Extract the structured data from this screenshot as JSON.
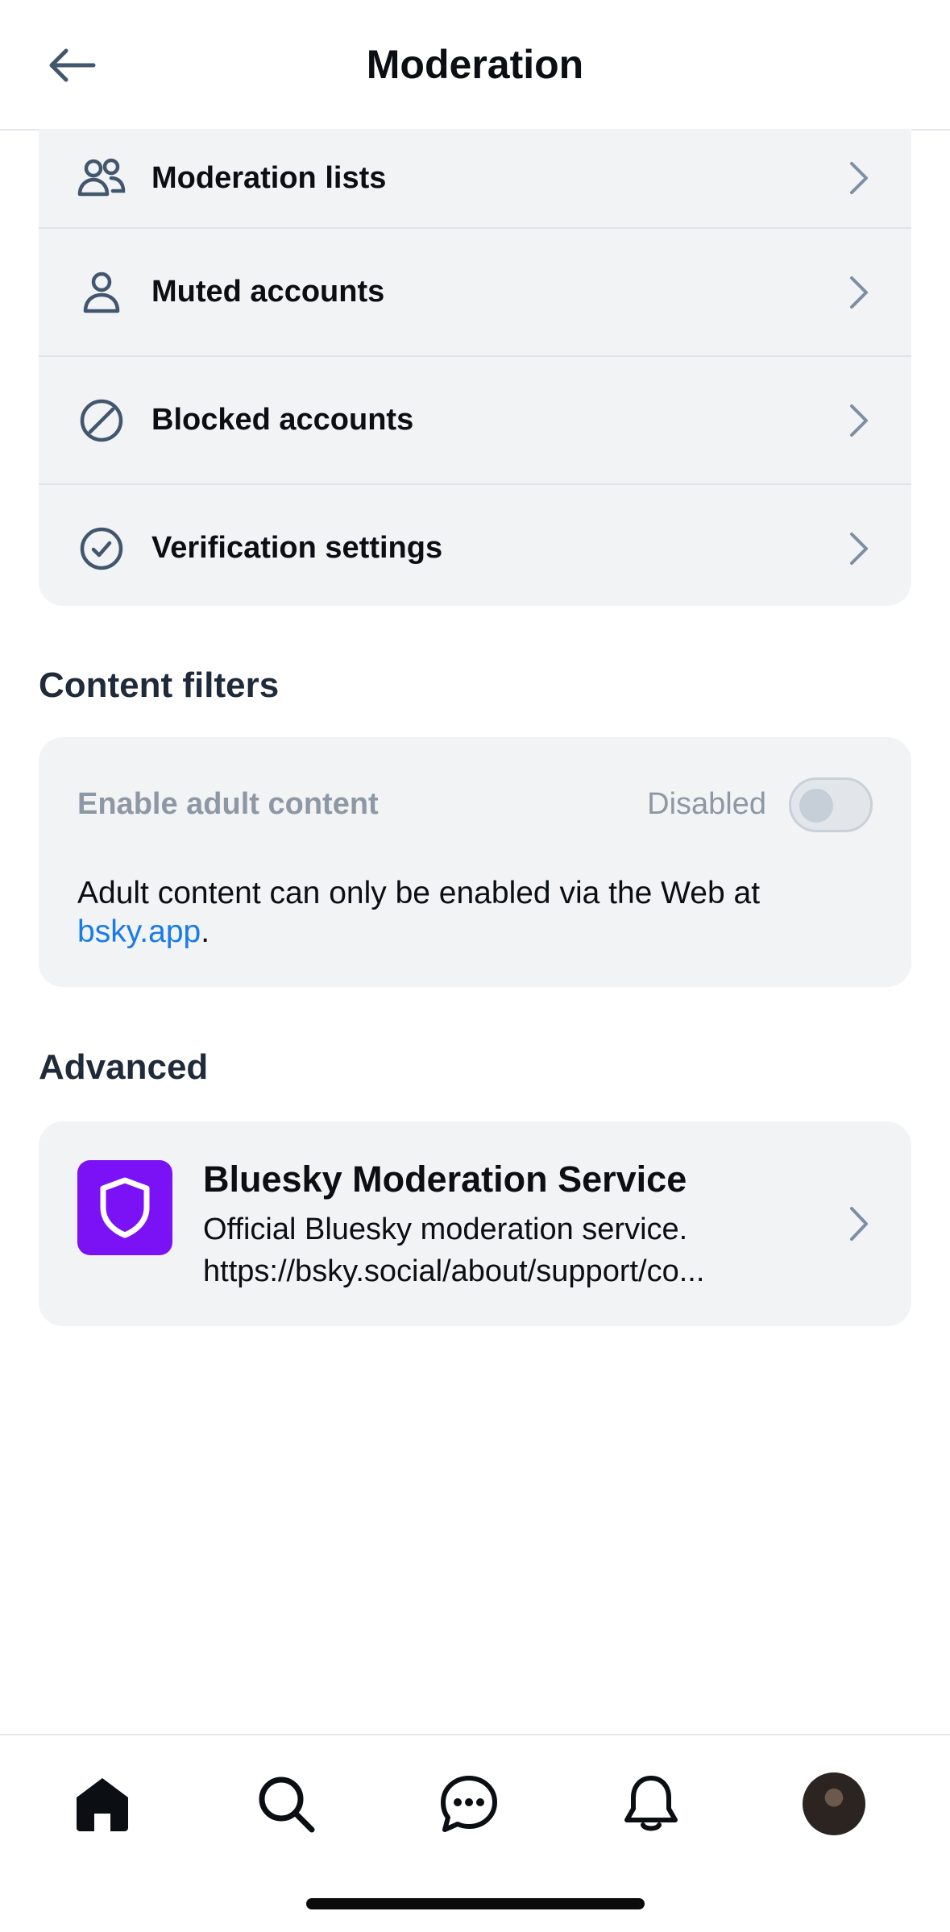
{
  "header": {
    "title": "Moderation",
    "back_icon": "arrow-left-icon"
  },
  "menu": {
    "items": [
      {
        "label": "Moderation lists",
        "icon": "people-icon"
      },
      {
        "label": "Muted accounts",
        "icon": "person-icon"
      },
      {
        "label": "Blocked accounts",
        "icon": "circle-slash-icon"
      },
      {
        "label": "Verification settings",
        "icon": "circle-check-icon"
      }
    ]
  },
  "content_filters": {
    "title": "Content filters",
    "adult_label": "Enable adult content",
    "status": "Disabled",
    "enabled": false,
    "note_prefix": "Adult content can only be enabled via the Web at ",
    "note_link": "bsky.app",
    "note_suffix": "."
  },
  "advanced": {
    "title": "Advanced",
    "service": {
      "name": "Bluesky Moderation Service",
      "description_line1": "Official Bluesky moderation service.",
      "description_line2": "https://bsky.social/about/support/co...",
      "logo_color": "#7b12f5"
    }
  },
  "nav": {
    "items": [
      "home-icon",
      "search-icon",
      "chat-icon",
      "bell-icon",
      "avatar"
    ]
  },
  "colors": {
    "accent_link": "#1a7be6",
    "icon": "#42566e",
    "card_bg": "#f1f3f5"
  }
}
